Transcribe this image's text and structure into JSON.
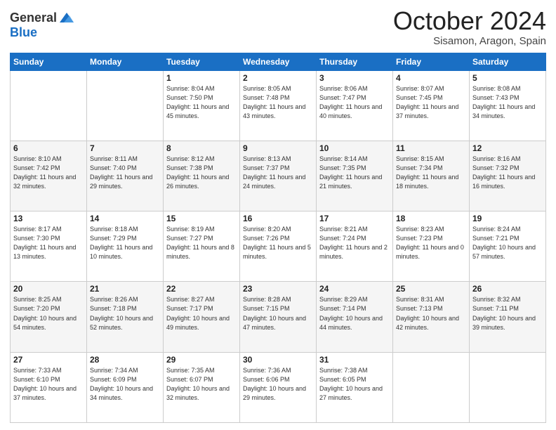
{
  "logo": {
    "line1": "General",
    "line2": "Blue"
  },
  "header": {
    "month": "October 2024",
    "location": "Sisamon, Aragon, Spain"
  },
  "weekdays": [
    "Sunday",
    "Monday",
    "Tuesday",
    "Wednesday",
    "Thursday",
    "Friday",
    "Saturday"
  ],
  "weeks": [
    [
      {
        "day": "",
        "sunrise": "",
        "sunset": "",
        "daylight": ""
      },
      {
        "day": "",
        "sunrise": "",
        "sunset": "",
        "daylight": ""
      },
      {
        "day": "1",
        "sunrise": "Sunrise: 8:04 AM",
        "sunset": "Sunset: 7:50 PM",
        "daylight": "Daylight: 11 hours and 45 minutes."
      },
      {
        "day": "2",
        "sunrise": "Sunrise: 8:05 AM",
        "sunset": "Sunset: 7:48 PM",
        "daylight": "Daylight: 11 hours and 43 minutes."
      },
      {
        "day": "3",
        "sunrise": "Sunrise: 8:06 AM",
        "sunset": "Sunset: 7:47 PM",
        "daylight": "Daylight: 11 hours and 40 minutes."
      },
      {
        "day": "4",
        "sunrise": "Sunrise: 8:07 AM",
        "sunset": "Sunset: 7:45 PM",
        "daylight": "Daylight: 11 hours and 37 minutes."
      },
      {
        "day": "5",
        "sunrise": "Sunrise: 8:08 AM",
        "sunset": "Sunset: 7:43 PM",
        "daylight": "Daylight: 11 hours and 34 minutes."
      }
    ],
    [
      {
        "day": "6",
        "sunrise": "Sunrise: 8:10 AM",
        "sunset": "Sunset: 7:42 PM",
        "daylight": "Daylight: 11 hours and 32 minutes."
      },
      {
        "day": "7",
        "sunrise": "Sunrise: 8:11 AM",
        "sunset": "Sunset: 7:40 PM",
        "daylight": "Daylight: 11 hours and 29 minutes."
      },
      {
        "day": "8",
        "sunrise": "Sunrise: 8:12 AM",
        "sunset": "Sunset: 7:38 PM",
        "daylight": "Daylight: 11 hours and 26 minutes."
      },
      {
        "day": "9",
        "sunrise": "Sunrise: 8:13 AM",
        "sunset": "Sunset: 7:37 PM",
        "daylight": "Daylight: 11 hours and 24 minutes."
      },
      {
        "day": "10",
        "sunrise": "Sunrise: 8:14 AM",
        "sunset": "Sunset: 7:35 PM",
        "daylight": "Daylight: 11 hours and 21 minutes."
      },
      {
        "day": "11",
        "sunrise": "Sunrise: 8:15 AM",
        "sunset": "Sunset: 7:34 PM",
        "daylight": "Daylight: 11 hours and 18 minutes."
      },
      {
        "day": "12",
        "sunrise": "Sunrise: 8:16 AM",
        "sunset": "Sunset: 7:32 PM",
        "daylight": "Daylight: 11 hours and 16 minutes."
      }
    ],
    [
      {
        "day": "13",
        "sunrise": "Sunrise: 8:17 AM",
        "sunset": "Sunset: 7:30 PM",
        "daylight": "Daylight: 11 hours and 13 minutes."
      },
      {
        "day": "14",
        "sunrise": "Sunrise: 8:18 AM",
        "sunset": "Sunset: 7:29 PM",
        "daylight": "Daylight: 11 hours and 10 minutes."
      },
      {
        "day": "15",
        "sunrise": "Sunrise: 8:19 AM",
        "sunset": "Sunset: 7:27 PM",
        "daylight": "Daylight: 11 hours and 8 minutes."
      },
      {
        "day": "16",
        "sunrise": "Sunrise: 8:20 AM",
        "sunset": "Sunset: 7:26 PM",
        "daylight": "Daylight: 11 hours and 5 minutes."
      },
      {
        "day": "17",
        "sunrise": "Sunrise: 8:21 AM",
        "sunset": "Sunset: 7:24 PM",
        "daylight": "Daylight: 11 hours and 2 minutes."
      },
      {
        "day": "18",
        "sunrise": "Sunrise: 8:23 AM",
        "sunset": "Sunset: 7:23 PM",
        "daylight": "Daylight: 11 hours and 0 minutes."
      },
      {
        "day": "19",
        "sunrise": "Sunrise: 8:24 AM",
        "sunset": "Sunset: 7:21 PM",
        "daylight": "Daylight: 10 hours and 57 minutes."
      }
    ],
    [
      {
        "day": "20",
        "sunrise": "Sunrise: 8:25 AM",
        "sunset": "Sunset: 7:20 PM",
        "daylight": "Daylight: 10 hours and 54 minutes."
      },
      {
        "day": "21",
        "sunrise": "Sunrise: 8:26 AM",
        "sunset": "Sunset: 7:18 PM",
        "daylight": "Daylight: 10 hours and 52 minutes."
      },
      {
        "day": "22",
        "sunrise": "Sunrise: 8:27 AM",
        "sunset": "Sunset: 7:17 PM",
        "daylight": "Daylight: 10 hours and 49 minutes."
      },
      {
        "day": "23",
        "sunrise": "Sunrise: 8:28 AM",
        "sunset": "Sunset: 7:15 PM",
        "daylight": "Daylight: 10 hours and 47 minutes."
      },
      {
        "day": "24",
        "sunrise": "Sunrise: 8:29 AM",
        "sunset": "Sunset: 7:14 PM",
        "daylight": "Daylight: 10 hours and 44 minutes."
      },
      {
        "day": "25",
        "sunrise": "Sunrise: 8:31 AM",
        "sunset": "Sunset: 7:13 PM",
        "daylight": "Daylight: 10 hours and 42 minutes."
      },
      {
        "day": "26",
        "sunrise": "Sunrise: 8:32 AM",
        "sunset": "Sunset: 7:11 PM",
        "daylight": "Daylight: 10 hours and 39 minutes."
      }
    ],
    [
      {
        "day": "27",
        "sunrise": "Sunrise: 7:33 AM",
        "sunset": "Sunset: 6:10 PM",
        "daylight": "Daylight: 10 hours and 37 minutes."
      },
      {
        "day": "28",
        "sunrise": "Sunrise: 7:34 AM",
        "sunset": "Sunset: 6:09 PM",
        "daylight": "Daylight: 10 hours and 34 minutes."
      },
      {
        "day": "29",
        "sunrise": "Sunrise: 7:35 AM",
        "sunset": "Sunset: 6:07 PM",
        "daylight": "Daylight: 10 hours and 32 minutes."
      },
      {
        "day": "30",
        "sunrise": "Sunrise: 7:36 AM",
        "sunset": "Sunset: 6:06 PM",
        "daylight": "Daylight: 10 hours and 29 minutes."
      },
      {
        "day": "31",
        "sunrise": "Sunrise: 7:38 AM",
        "sunset": "Sunset: 6:05 PM",
        "daylight": "Daylight: 10 hours and 27 minutes."
      },
      {
        "day": "",
        "sunrise": "",
        "sunset": "",
        "daylight": ""
      },
      {
        "day": "",
        "sunrise": "",
        "sunset": "",
        "daylight": ""
      }
    ]
  ]
}
